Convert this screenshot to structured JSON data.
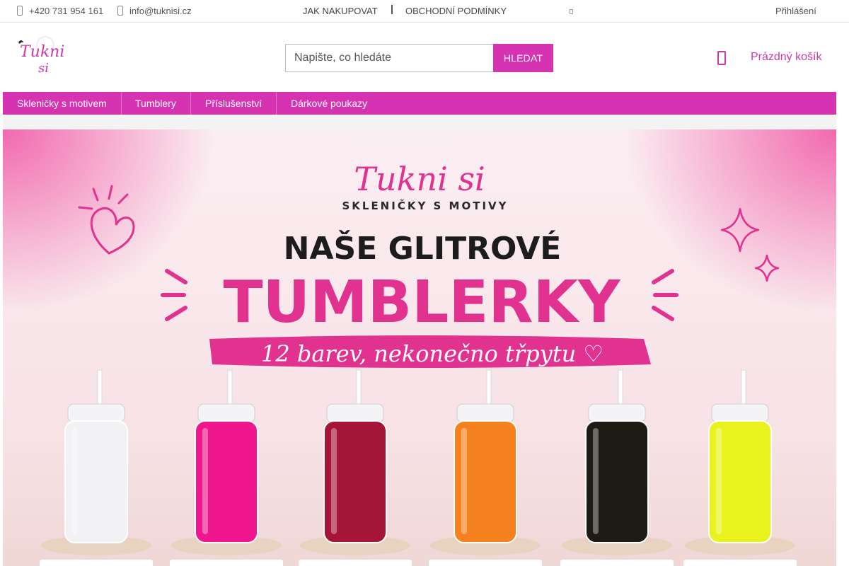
{
  "topbar": {
    "phone": "+420 731 954 161",
    "email": "info@tuknisi.cz",
    "links": [
      "JAK NAKUPOVAT",
      "OBCHODNÍ PODMÍNKY"
    ],
    "login": "Přihlášení"
  },
  "header": {
    "logo_line1": "Tukni",
    "logo_line2": "si",
    "search_placeholder": "Napište, co hledáte",
    "search_value": "",
    "search_button": "HLEDAT",
    "cart_label": "Prázdný košík"
  },
  "nav": {
    "items": [
      "Skleničky s motivem",
      "Tumblery",
      "Příslušenství",
      "Dárkové poukazy"
    ]
  },
  "banner": {
    "brand": "Tukni si",
    "tagline": "SKLENIČKY S MOTIVY",
    "headline1": "NAŠE GLITROVÉ",
    "headline2": "TUMBLERKY",
    "ribbon": "12 barev, nekonečno třpytu ♡",
    "tumbler_colors": [
      "#f2f2f4",
      "#f0178e",
      "#a51537",
      "#f6821f",
      "#1e1a14",
      "#e9f21c"
    ]
  },
  "colors": {
    "accent": "#d633b3",
    "accent_text": "#c93aa8",
    "banner_pink": "#e2328f",
    "banner_bg": "#fbe9ee"
  },
  "icons": [
    "phone-icon",
    "mail-icon",
    "cart-icon",
    "heart-icon",
    "sparkle-icon"
  ]
}
